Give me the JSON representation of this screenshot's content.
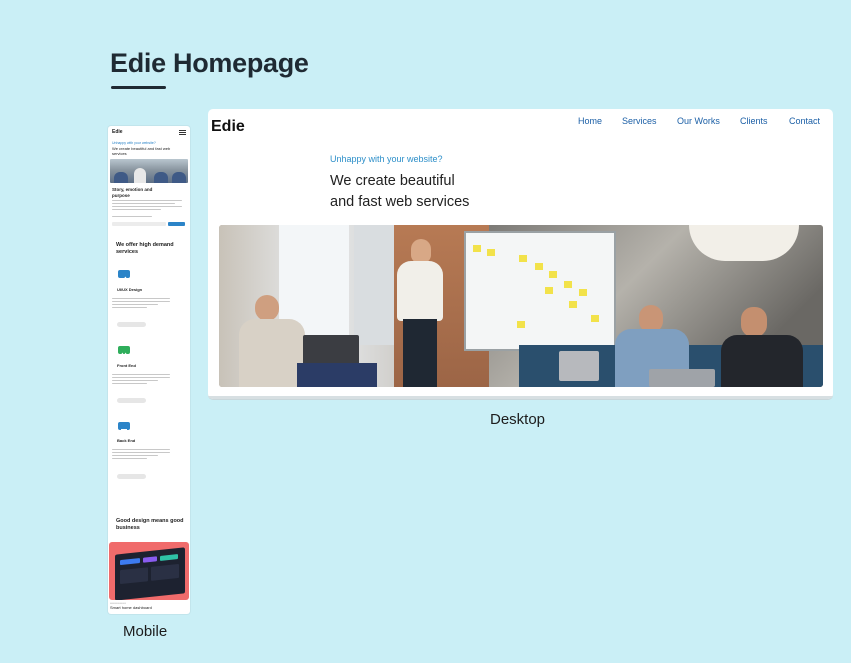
{
  "board": {
    "title": "Edie Homepage",
    "mobile_label": "Mobile",
    "desktop_label": "Desktop"
  },
  "desktop": {
    "logo": "Edie",
    "nav": [
      "Home",
      "Services",
      "Our Works",
      "Clients",
      "Contact"
    ],
    "tagline": "Unhappy with your website?",
    "headline_line1": "We create beautiful",
    "headline_line2": "and fast web services"
  },
  "mobile": {
    "logo": "Edie",
    "tagline": "Unhappy with your website?",
    "headline": "We create beautiful and fast web services",
    "story_heading": "Story, emotion and purpose",
    "services_heading": "We offer high demand services",
    "services": [
      {
        "title": "UI/UX Design",
        "icon": "pen-icon",
        "color": "#2b84c8"
      },
      {
        "title": "Front End",
        "icon": "code-icon",
        "color": "#2fae5b"
      },
      {
        "title": "Back End",
        "icon": "server-icon",
        "color": "#2b84c8"
      }
    ],
    "design_heading": "Good design means good business",
    "card_caption": "Smart home dashboard"
  },
  "colors": {
    "canvas": "#caeff6",
    "accent_blue": "#2b84c8",
    "nav_blue": "#1b5fa6"
  }
}
